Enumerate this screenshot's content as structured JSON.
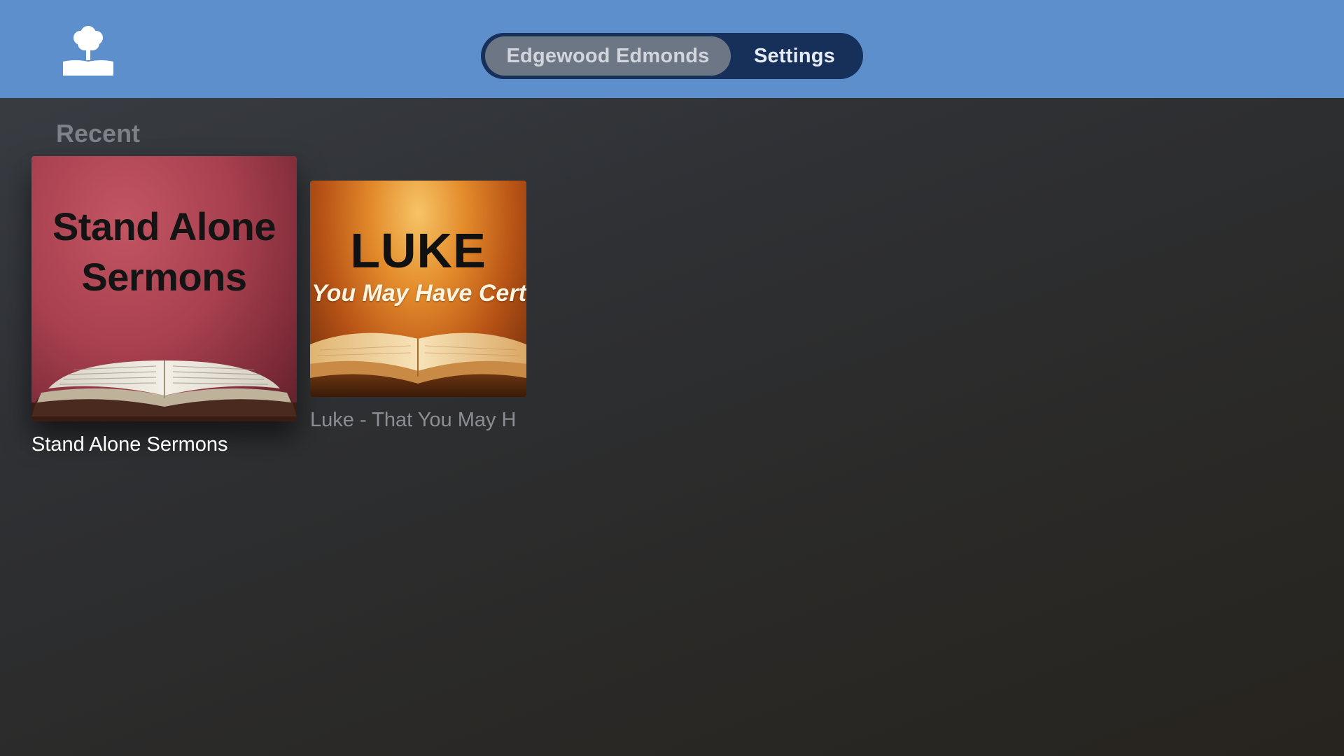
{
  "header": {
    "logo_icon": "tree-on-book-icon",
    "nav": {
      "selected_label": "Edgewood Edmonds",
      "settings_label": "Settings"
    }
  },
  "main": {
    "section_title": "Recent",
    "items": [
      {
        "art_line1": "Stand Alone",
        "art_line2": "Sermons",
        "caption": "Stand Alone Sermons",
        "art_icon": "open-bible-icon",
        "focused": true
      },
      {
        "art_title": "LUKE",
        "art_subtitle": "t You May Have Certa",
        "caption": "Luke - That You May H",
        "art_icon": "open-bible-icon",
        "focused": false
      }
    ]
  },
  "colors": {
    "header_bg": "#5c8fcb",
    "segmented_bg": "#17305a",
    "selected_pill": "#6d7685"
  }
}
